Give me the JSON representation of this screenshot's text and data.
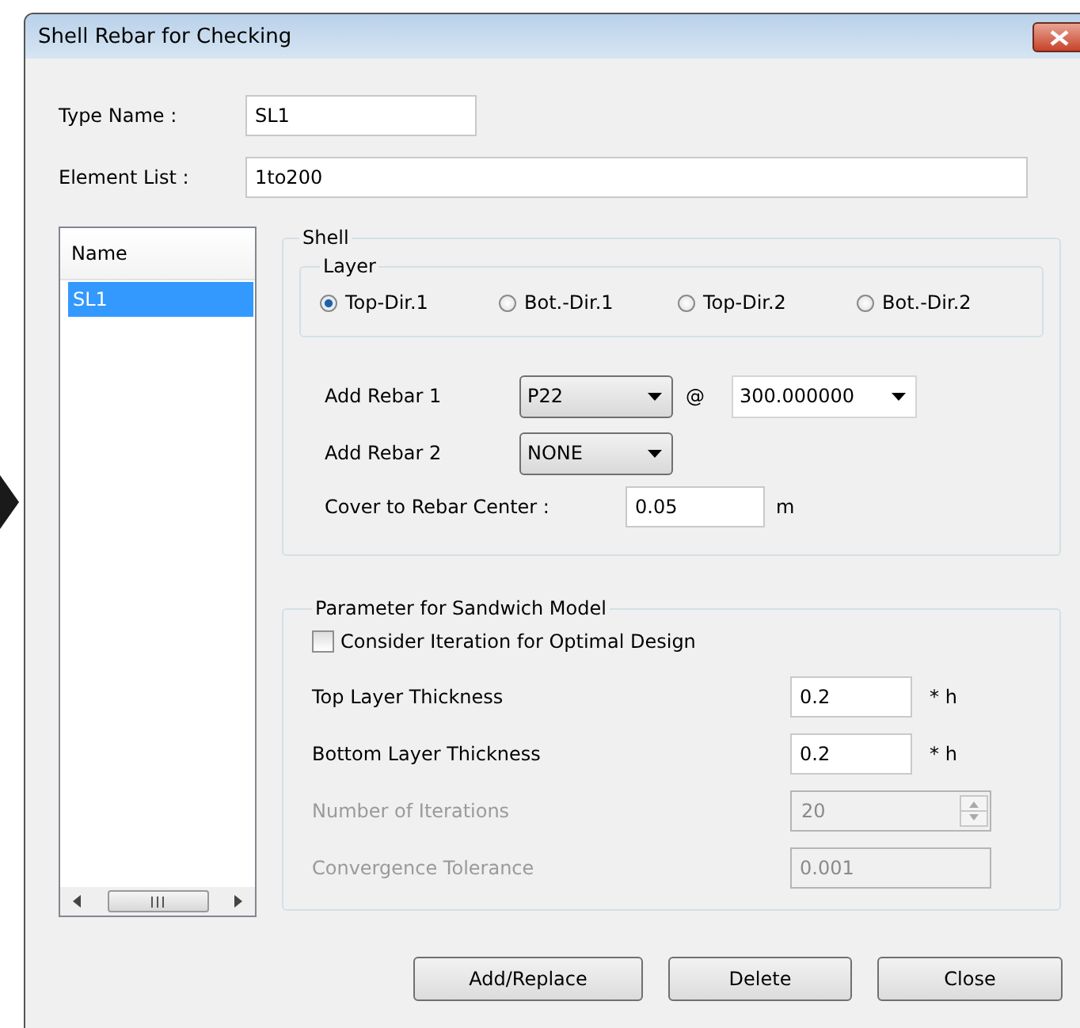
{
  "window": {
    "title": "Shell Rebar for Checking"
  },
  "type_name": {
    "label": "Type Name :",
    "value": "SL1"
  },
  "element_list": {
    "label": "Element List :",
    "value": "1to200"
  },
  "list": {
    "header": "Name",
    "items": [
      {
        "label": "SL1",
        "selected": true
      }
    ]
  },
  "shell": {
    "title": "Shell",
    "layer": {
      "title": "Layer",
      "options": [
        {
          "label": "Top-Dir.1",
          "selected": true
        },
        {
          "label": "Bot.-Dir.1",
          "selected": false
        },
        {
          "label": "Top-Dir.2",
          "selected": false
        },
        {
          "label": "Bot.-Dir.2",
          "selected": false
        }
      ]
    },
    "rebar1": {
      "label": "Add Rebar 1",
      "bar": "P22",
      "separator": "@",
      "spacing": "300.000000"
    },
    "rebar2": {
      "label": "Add Rebar 2",
      "bar": "NONE"
    },
    "cover": {
      "label": "Cover to Rebar Center :",
      "value": "0.05",
      "unit": "m"
    }
  },
  "sandwich": {
    "title": "Parameter for Sandwich Model",
    "option": {
      "label": "Consider Iteration for Optimal Design",
      "checked": false
    },
    "rows": [
      {
        "kind": "field",
        "label": "Top Layer Thickness",
        "value": "0.2",
        "unit": "* h",
        "disabled": false
      },
      {
        "kind": "field",
        "label": "Bottom Layer Thickness",
        "value": "0.2",
        "unit": "* h",
        "disabled": false
      },
      {
        "kind": "spinner",
        "label": "Number of Iterations",
        "value": "20",
        "disabled": true
      },
      {
        "kind": "field",
        "label": "Convergence Tolerance",
        "value": "0.001",
        "disabled": true
      }
    ]
  },
  "buttons": [
    "Add/Replace",
    "Delete",
    "Close"
  ]
}
